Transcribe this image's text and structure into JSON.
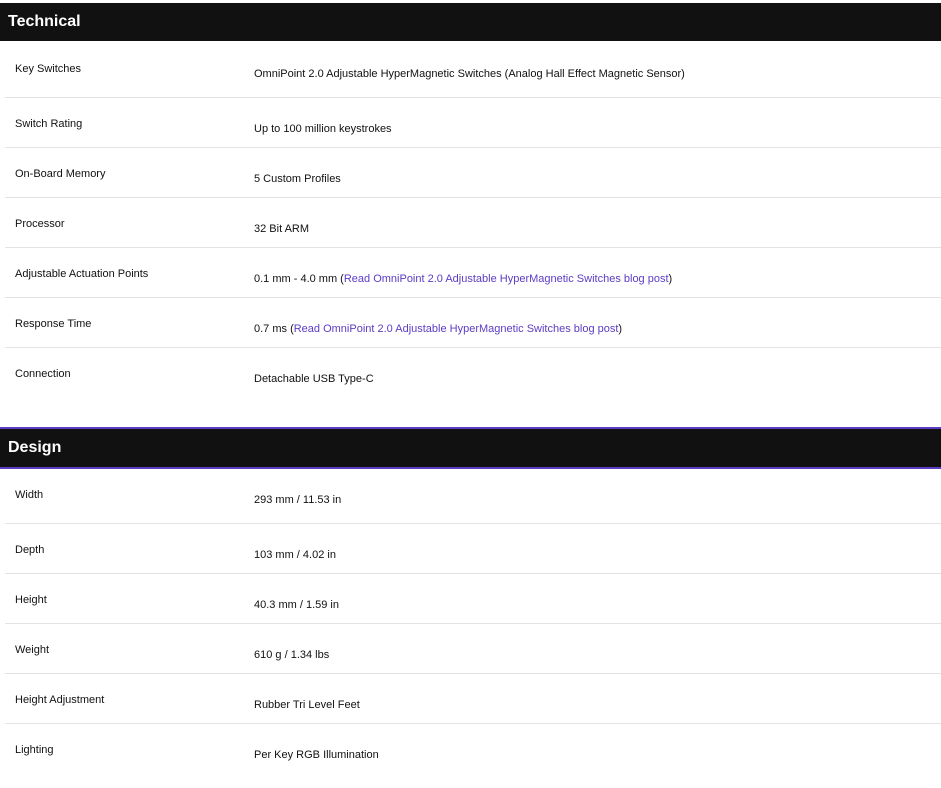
{
  "technical": {
    "title": "Technical",
    "rows": [
      {
        "label": "Key Switches",
        "value": "OmniPoint 2.0 Adjustable HyperMagnetic Switches (Analog Hall Effect Magnetic Sensor)"
      },
      {
        "label": "Switch Rating",
        "value": "Up to 100 million keystrokes"
      },
      {
        "label": "On-Board Memory",
        "value": "5 Custom Profiles"
      },
      {
        "label": "Processor",
        "value": "32 Bit ARM"
      },
      {
        "label": "Adjustable Actuation Points",
        "value_prefix": "0.1 mm - 4.0 mm (",
        "link_text": "Read OmniPoint 2.0 Adjustable HyperMagnetic Switches blog post",
        "value_suffix": ")"
      },
      {
        "label": "Response Time",
        "value_prefix": "0.7 ms (",
        "link_text": "Read OmniPoint 2.0 Adjustable HyperMagnetic Switches blog post",
        "value_suffix": ")"
      },
      {
        "label": "Connection",
        "value": "Detachable USB Type-C"
      }
    ]
  },
  "design": {
    "title": "Design",
    "rows": [
      {
        "label": "Width",
        "value": "293 mm / 11.53 in"
      },
      {
        "label": "Depth",
        "value": "103 mm / 4.02 in"
      },
      {
        "label": "Height",
        "value": "40.3 mm / 1.59 in"
      },
      {
        "label": "Weight",
        "value": "610 g / 1.34 lbs"
      },
      {
        "label": "Height Adjustment",
        "value": "Rubber Tri Level Feet"
      },
      {
        "label": "Lighting",
        "value": "Per Key RGB Illumination"
      }
    ]
  },
  "colors": {
    "header_bg": "#111111",
    "accent": "#5b3cc4",
    "link": "#5b3cc4",
    "divider": "#e2e2e2"
  }
}
